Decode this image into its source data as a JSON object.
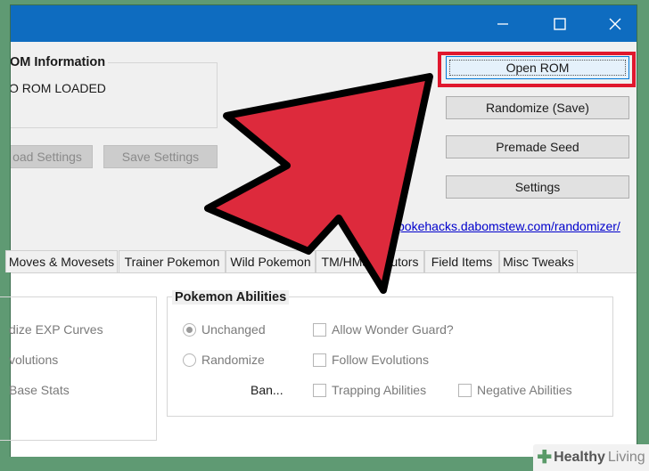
{
  "window": {
    "controls": {
      "minimize_icon": "minimize-icon",
      "maximize_icon": "maximize-icon",
      "close_icon": "close-icon"
    }
  },
  "rom_info": {
    "group_title": "OM Information",
    "status_text": "O ROM LOADED"
  },
  "settings_buttons": {
    "load_label": "oad Settings",
    "save_label": "Save Settings"
  },
  "actions": {
    "open_rom_label": "Open ROM",
    "randomize_label": "Randomize (Save)",
    "premade_seed_label": "Premade Seed",
    "settings_label": "Settings"
  },
  "link": {
    "text": "http://pokehacks.dabomstew.com/randomizer/"
  },
  "tabs": [
    {
      "label": "Moves & Movesets"
    },
    {
      "label": "Trainer Pokemon"
    },
    {
      "label": "Wild Pokemon"
    },
    {
      "label": "TM/HMs & Tutors"
    },
    {
      "label": "Field Items"
    },
    {
      "label": "Misc Tweaks"
    }
  ],
  "left_column": {
    "items": [
      {
        "label": "dize EXP Curves"
      },
      {
        "label": "volutions"
      },
      {
        "label": "Base Stats"
      }
    ]
  },
  "abilities": {
    "group_title": "Pokemon Abilities",
    "unchanged_label": "Unchanged",
    "randomize_label": "Randomize",
    "ban_label": "Ban...",
    "allow_wonder_guard_label": "Allow Wonder Guard?",
    "follow_evolutions_label": "Follow Evolutions",
    "trapping_abilities_label": "Trapping Abilities",
    "negative_abilities_label": "Negative Abilities",
    "selected": "Unchanged"
  },
  "watermark": {
    "brand_a": "Healthy",
    "brand_b": "Living",
    "icon": "plus-icon"
  },
  "colors": {
    "titlebar": "#0e6cc0",
    "arrow_fill": "#dd2a3c",
    "highlight_border": "#e0182e",
    "background": "#5f9a73"
  }
}
